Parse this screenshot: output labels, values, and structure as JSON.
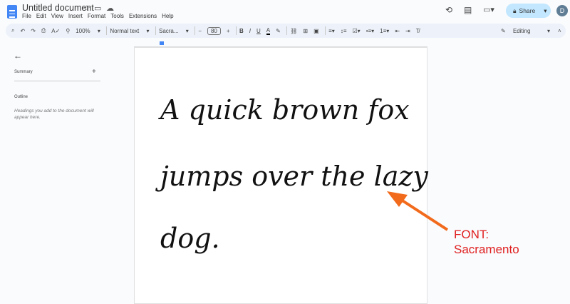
{
  "header": {
    "title": "Untitled document",
    "menu": [
      "File",
      "Edit",
      "View",
      "Insert",
      "Format",
      "Tools",
      "Extensions",
      "Help"
    ],
    "share": "Share",
    "avatar": "D"
  },
  "toolbar": {
    "zoom": "100%",
    "style": "Normal text",
    "font": "Sacra...",
    "font_size": "80",
    "mode": "Editing"
  },
  "sidebar": {
    "summary": "Summary",
    "outline": "Outline",
    "outline_hint": "Headings you add to the document will appear here."
  },
  "document": {
    "lines": [
      "A quick brown fox",
      "jumps over the lazy",
      "dog."
    ]
  },
  "annotation": {
    "line1": "FONT:",
    "line2": "Sacramento",
    "color": "#e02020",
    "arrow_color": "#f26a1b"
  }
}
